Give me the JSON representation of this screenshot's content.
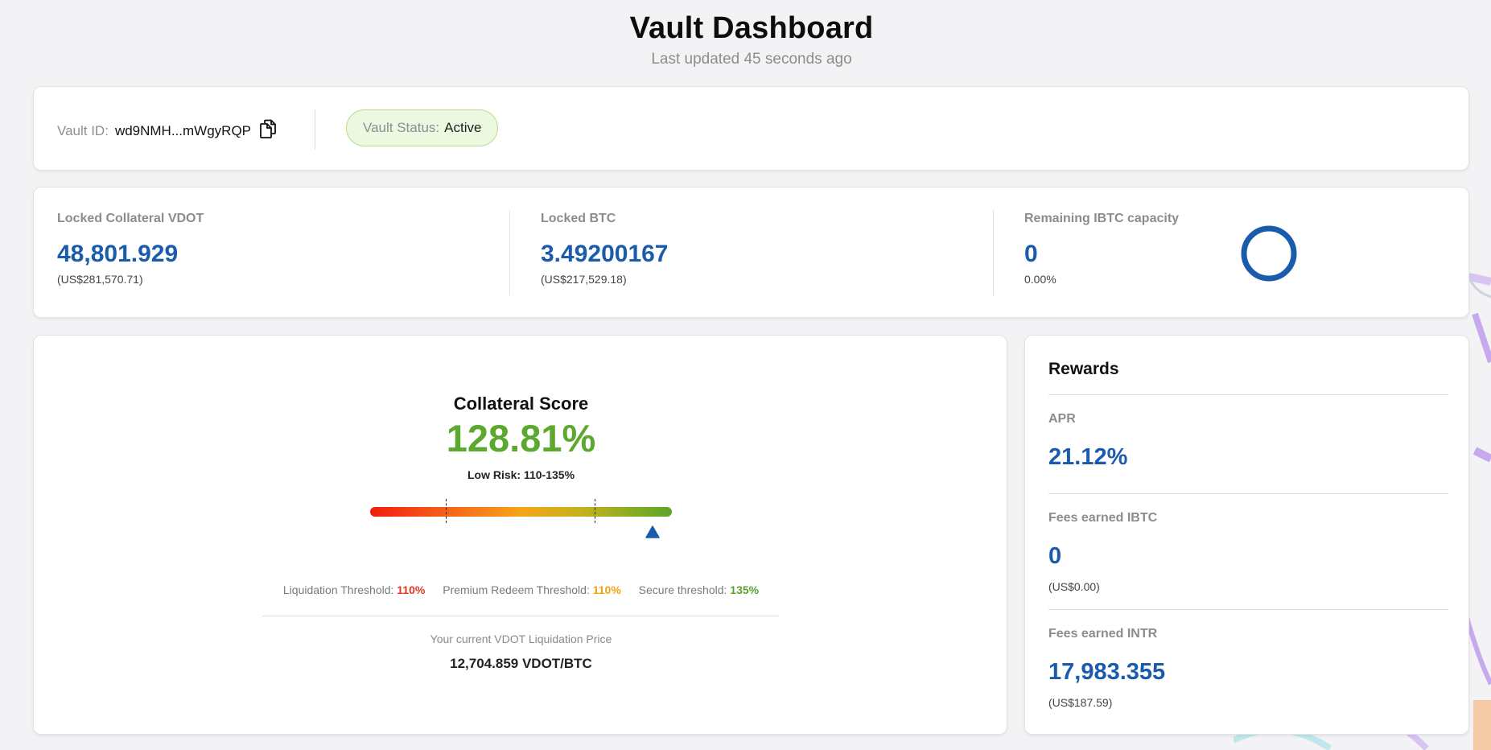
{
  "header": {
    "title": "Vault Dashboard",
    "subtitle": "Last updated 45 seconds ago"
  },
  "vault": {
    "id_label": "Vault ID:",
    "id_value": "wd9NMH...mWgyRQP",
    "status_label": "Vault Status:",
    "status_value": "Active"
  },
  "stats": {
    "collateral": {
      "label": "Locked Collateral VDOT",
      "value": "48,801.929",
      "usd": "(US$281,570.71)"
    },
    "btc": {
      "label": "Locked BTC",
      "value": "3.49200167",
      "usd": "(US$217,529.18)"
    },
    "capacity": {
      "label": "Remaining IBTC capacity",
      "value": "0",
      "percent": "0.00%"
    }
  },
  "score": {
    "title": "Collateral Score",
    "value": "128.81%",
    "risk": "Low Risk: 110-135%",
    "liquidation_label": "Liquidation Threshold:",
    "liquidation_value": "110%",
    "premium_label": "Premium Redeem Threshold:",
    "premium_value": "110%",
    "secure_label": "Secure threshold:",
    "secure_value": "135%",
    "liq_price_label": "Your current VDOT Liquidation Price",
    "liq_price_value": "12,704.859 VDOT/BTC"
  },
  "rewards": {
    "title": "Rewards",
    "apr_label": "APR",
    "apr_value": "21.12%",
    "ibtc_label": "Fees earned IBTC",
    "ibtc_value": "0",
    "ibtc_usd": "(US$0.00)",
    "intr_label": "Fees earned INTR",
    "intr_value": "17,983.355",
    "intr_usd": "(US$187.59)"
  },
  "colors": {
    "accent_blue": "#1a5cab",
    "score_green": "#5da82e",
    "status_bg": "#ecf8e0"
  },
  "icons": {
    "copy": "copy-icon",
    "capacity_ring": "ring-icon",
    "marker": "triangle-marker-icon"
  }
}
